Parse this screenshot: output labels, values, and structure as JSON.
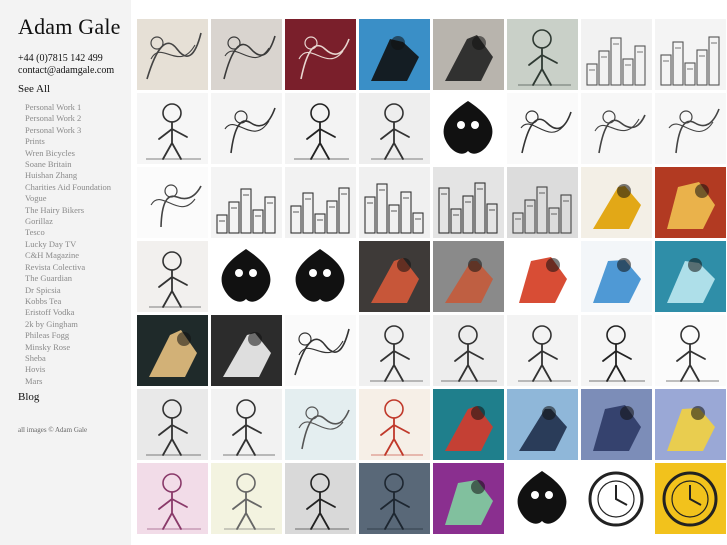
{
  "site": {
    "name": "Adam Gale",
    "phone": "+44 (0)7815 142 499",
    "email": "contact@adamgale.com"
  },
  "nav": {
    "see_all": "See All",
    "blog": "Blog",
    "clients": [
      "Personal Work 1",
      "Personal Work 2",
      "Personal Work 3",
      "Prints",
      "Wren Bicycles",
      "Soane Britain",
      "Huishan Zhang",
      "Charities Aid Foundation",
      "Vogue",
      "The Hairy Bikers",
      "Gorillaz",
      "Tesco",
      "Lucky Day TV",
      "C&H Magazine",
      "Revista Colectiva",
      "The Guardian",
      "Dr Spicsia",
      "Kobbs Tea",
      "Eristoff Vodka",
      "2k by Gingham",
      "Phileas Fogg",
      "Minsky Rose",
      "Sheba",
      "Hovis",
      "Mars"
    ]
  },
  "footer": {
    "copyright": "all images © Adam Gale"
  },
  "thumbnails": [
    {
      "name": "thumb-ram-sketch",
      "icon": "ram-sketch-icon",
      "bg": "#e6e0d6",
      "fg": "#444444",
      "style": "sketch"
    },
    {
      "name": "thumb-antelope-sketch",
      "icon": "antelope-sketch-icon",
      "bg": "#d9d4cf",
      "fg": "#3a3a3a",
      "style": "sketch"
    },
    {
      "name": "thumb-ram-red",
      "icon": "ram-red-icon",
      "bg": "#7a1f2b",
      "fg": "#e8d6d0",
      "style": "sketch"
    },
    {
      "name": "thumb-antelope-blue",
      "icon": "antelope-blue-icon",
      "bg": "#3a8fc7",
      "fg": "#111111",
      "style": "bold"
    },
    {
      "name": "thumb-antelope-grey",
      "icon": "antelope-grey-icon",
      "bg": "#b8b4ad",
      "fg": "#222222",
      "style": "bold"
    },
    {
      "name": "thumb-cyclist",
      "icon": "cyclist-icon",
      "bg": "#c9d0c8",
      "fg": "#2f3a33",
      "style": "figure"
    },
    {
      "name": "thumb-city-sketch",
      "icon": "city-sketch-icon",
      "bg": "#f2f2f2",
      "fg": "#555555",
      "style": "city"
    },
    {
      "name": "thumb-statue-liberty",
      "icon": "statue-liberty-icon",
      "bg": "#f4f4f4",
      "fg": "#555555",
      "style": "city"
    },
    {
      "name": "thumb-painter",
      "icon": "painter-icon",
      "bg": "#f6f6f6",
      "fg": "#333333",
      "style": "figure"
    },
    {
      "name": "thumb-soane-sketch",
      "icon": "soane-sketch-icon",
      "bg": "#f5f5f5",
      "fg": "#333333",
      "style": "sketch"
    },
    {
      "name": "thumb-man-hat",
      "icon": "man-hat-icon",
      "bg": "#f3f3f3",
      "fg": "#222222",
      "style": "figure"
    },
    {
      "name": "thumb-two-men",
      "icon": "two-men-icon",
      "bg": "#eeeeee",
      "fg": "#333333",
      "style": "figure"
    },
    {
      "name": "thumb-black-pattern",
      "icon": "black-pattern-icon",
      "bg": "#ffffff",
      "fg": "#111111",
      "style": "blob"
    },
    {
      "name": "thumb-globe-sketch",
      "icon": "globe-sketch-icon",
      "bg": "#fafafa",
      "fg": "#333333",
      "style": "sketch"
    },
    {
      "name": "thumb-hands-sketch",
      "icon": "hands-sketch-icon",
      "bg": "#f7f7f7",
      "fg": "#444444",
      "style": "sketch"
    },
    {
      "name": "thumb-hands-sketch-2",
      "icon": "hands-sketch-2-icon",
      "bg": "#f7f7f7",
      "fg": "#444444",
      "style": "sketch"
    },
    {
      "name": "thumb-reach-sketch",
      "icon": "reach-sketch-icon",
      "bg": "#fbfbfb",
      "fg": "#444444",
      "style": "sketch"
    },
    {
      "name": "thumb-building-ornate",
      "icon": "building-ornate-icon",
      "bg": "#f4f4f4",
      "fg": "#333333",
      "style": "city"
    },
    {
      "name": "thumb-street-houses",
      "icon": "street-houses-icon",
      "bg": "#f2f2f2",
      "fg": "#333333",
      "style": "city"
    },
    {
      "name": "thumb-shopfront",
      "icon": "shopfront-icon",
      "bg": "#f0f0f0",
      "fg": "#333333",
      "style": "city"
    },
    {
      "name": "thumb-london-skyline",
      "icon": "london-skyline-icon",
      "bg": "#e4e4e4",
      "fg": "#333333",
      "style": "city"
    },
    {
      "name": "thumb-station-sketch",
      "icon": "station-sketch-icon",
      "bg": "#dcdcdc",
      "fg": "#444444",
      "style": "city"
    },
    {
      "name": "thumb-yellow-figure",
      "icon": "yellow-figure-icon",
      "bg": "#f3efe6",
      "fg": "#e0a000",
      "style": "bold"
    },
    {
      "name": "thumb-lion",
      "icon": "lion-icon",
      "bg": "#b23a22",
      "fg": "#f0c050",
      "style": "bold"
    },
    {
      "name": "thumb-hairy-bikers",
      "icon": "hairy-bikers-icon",
      "bg": "#f2f0ee",
      "fg": "#333333",
      "style": "figure"
    },
    {
      "name": "thumb-eagle-crest",
      "icon": "eagle-crest-icon",
      "bg": "#ffffff",
      "fg": "#111111",
      "style": "blob"
    },
    {
      "name": "thumb-silhouette-house",
      "icon": "silhouette-house-icon",
      "bg": "#ffffff",
      "fg": "#111111",
      "style": "blob"
    },
    {
      "name": "thumb-octopus-chef",
      "icon": "octopus-chef-icon",
      "bg": "#3e3a38",
      "fg": "#d65a3a",
      "style": "bold"
    },
    {
      "name": "thumb-pelican",
      "icon": "pelican-icon",
      "bg": "#8a8a8a",
      "fg": "#c45a3a",
      "style": "bold"
    },
    {
      "name": "thumb-racing-car",
      "icon": "racing-car-icon",
      "bg": "#ffffff",
      "fg": "#d43a1f",
      "style": "bold"
    },
    {
      "name": "thumb-boat",
      "icon": "boat-icon",
      "bg": "#f3f6f9",
      "fg": "#3d8fd0",
      "style": "bold"
    },
    {
      "name": "thumb-underwater",
      "icon": "underwater-icon",
      "bg": "#2f8ea8",
      "fg": "#bde8f0",
      "style": "bold"
    },
    {
      "name": "thumb-portrait-dark",
      "icon": "portrait-dark-icon",
      "bg": "#1f2a2a",
      "fg": "#e6c080",
      "style": "bold"
    },
    {
      "name": "thumb-seagull",
      "icon": "seagull-icon",
      "bg": "#2c2c2c",
      "fg": "#f2f2f2",
      "style": "bold"
    },
    {
      "name": "thumb-flowers-sketch",
      "icon": "flowers-sketch-icon",
      "bg": "#fafafa",
      "fg": "#333333",
      "style": "sketch"
    },
    {
      "name": "thumb-sailors",
      "icon": "sailors-icon",
      "bg": "#f0f0f0",
      "fg": "#333333",
      "style": "figure"
    },
    {
      "name": "thumb-astronaut",
      "icon": "astronaut-icon",
      "bg": "#ededed",
      "fg": "#333333",
      "style": "figure"
    },
    {
      "name": "thumb-protest",
      "icon": "protest-icon",
      "bg": "#f3f3f3",
      "fg": "#333333",
      "style": "figure"
    },
    {
      "name": "thumb-crowd-sketch",
      "icon": "crowd-sketch-icon",
      "bg": "#f5f5f5",
      "fg": "#222222",
      "style": "figure"
    },
    {
      "name": "thumb-sunglasses-man",
      "icon": "sunglasses-man-icon",
      "bg": "#fbfbfb",
      "fg": "#333333",
      "style": "figure"
    },
    {
      "name": "thumb-bar-scene",
      "icon": "bar-scene-icon",
      "bg": "#e9e9e9",
      "fg": "#333333",
      "style": "figure"
    },
    {
      "name": "thumb-hipster",
      "icon": "hipster-icon",
      "bg": "#f2f2f2",
      "fg": "#333333",
      "style": "figure"
    },
    {
      "name": "thumb-cafe-sketch",
      "icon": "cafe-sketch-icon",
      "bg": "#e4eef0",
      "fg": "#555555",
      "style": "sketch"
    },
    {
      "name": "thumb-red-hair-woman",
      "icon": "red-hair-woman-icon",
      "bg": "#f6efe7",
      "fg": "#c0392b",
      "style": "figure"
    },
    {
      "name": "thumb-santa-waiter",
      "icon": "santa-waiter-icon",
      "bg": "#1f7f8c",
      "fg": "#d63a2a",
      "style": "bold"
    },
    {
      "name": "thumb-businessman",
      "icon": "businessman-icon",
      "bg": "#8fb7d9",
      "fg": "#1f2f4a",
      "style": "bold"
    },
    {
      "name": "thumb-blue-newspaper",
      "icon": "blue-newspaper-icon",
      "bg": "#7c8db8",
      "fg": "#2e3a66",
      "style": "bold"
    },
    {
      "name": "thumb-yellow-kid",
      "icon": "yellow-kid-icon",
      "bg": "#9aa8d6",
      "fg": "#f2d040",
      "style": "bold"
    },
    {
      "name": "thumb-girl-headphones",
      "icon": "girl-headphones-icon",
      "bg": "#f2dce8",
      "fg": "#8a3a6a",
      "style": "figure"
    },
    {
      "name": "thumb-runner",
      "icon": "runner-icon",
      "bg": "#f3f3e0",
      "fg": "#666666",
      "style": "figure"
    },
    {
      "name": "thumb-table-book",
      "icon": "table-book-icon",
      "bg": "#d9d9d9",
      "fg": "#222222",
      "style": "figure"
    },
    {
      "name": "thumb-dark-figures",
      "icon": "dark-figures-icon",
      "bg": "#596878",
      "fg": "#1d2630",
      "style": "figure"
    },
    {
      "name": "thumb-purple-monster",
      "icon": "purple-monster-icon",
      "bg": "#8a2f8f",
      "fg": "#7fd0a0",
      "style": "bold"
    },
    {
      "name": "thumb-wolf-badge",
      "icon": "wolf-badge-icon",
      "bg": "#ffffff",
      "fg": "#111111",
      "style": "blob"
    },
    {
      "name": "thumb-mexico-stamp",
      "icon": "mexico-stamp-icon",
      "bg": "#ffffff",
      "fg": "#222222",
      "style": "stamp"
    },
    {
      "name": "thumb-clocks",
      "icon": "clocks-icon",
      "bg": "#f2c21c",
      "fg": "#222222",
      "style": "stamp"
    }
  ]
}
